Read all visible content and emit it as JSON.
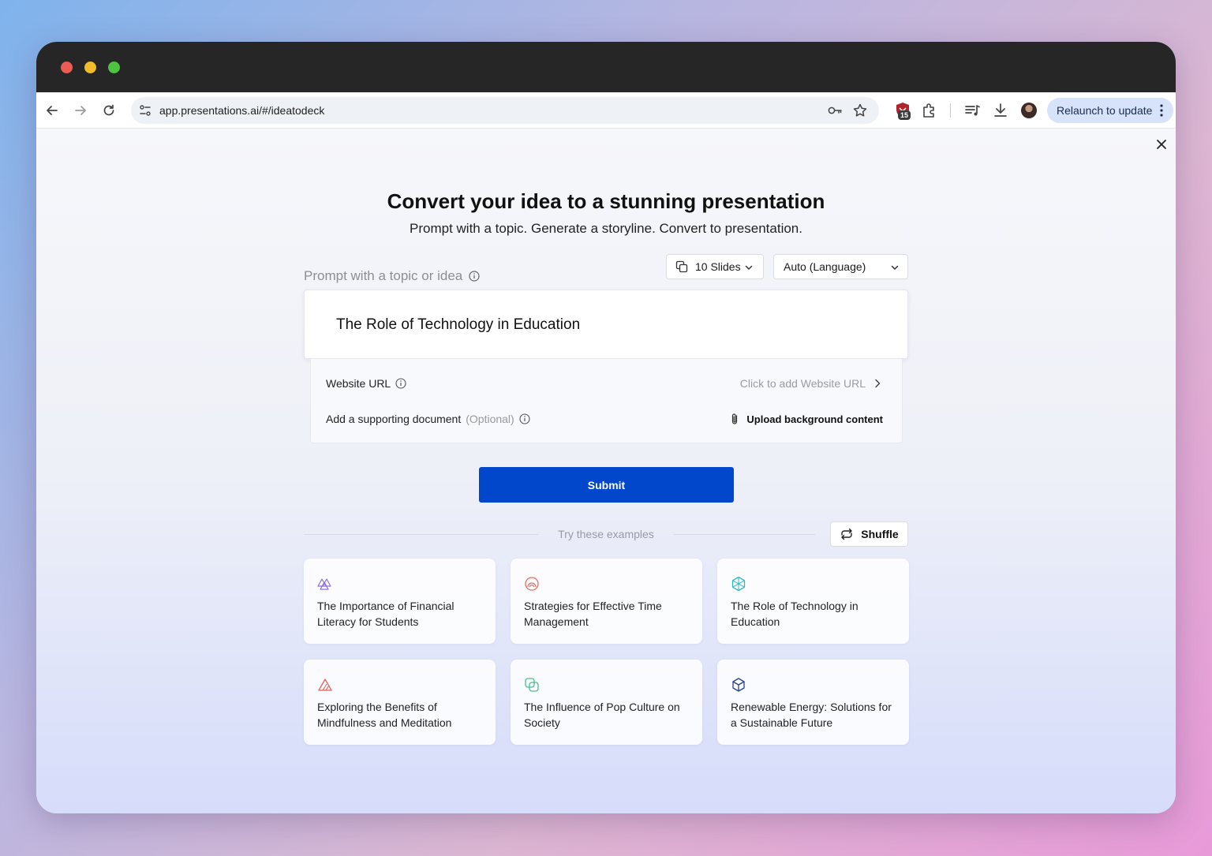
{
  "browser": {
    "url": "app.presentations.ai/#/ideatodeck",
    "extension_badge": "15",
    "relaunch_label": "Relaunch to update"
  },
  "page": {
    "heading": "Convert your idea to a stunning presentation",
    "subheading": "Prompt with a topic. Generate a storyline. Convert to presentation.",
    "prompt_label": "Prompt with a topic or idea",
    "slides_dropdown": "10 Slides",
    "language_dropdown": "Auto (Language)",
    "prompt_value": "The Role of Technology in Education",
    "website_url_label": "Website URL",
    "website_url_action": "Click to add Website URL",
    "supporting_doc_label": "Add a supporting document",
    "supporting_doc_optional": "(Optional)",
    "upload_label": "Upload background content",
    "submit_label": "Submit",
    "examples_label": "Try these examples",
    "shuffle_label": "Shuffle"
  },
  "examples": [
    {
      "text": "The Importance of Financial Literacy for Students",
      "icon": "triangles-icon",
      "color": "#8f6fd8"
    },
    {
      "text": "Strategies for Effective Time Management",
      "icon": "arcs-icon",
      "color": "#e86e5e"
    },
    {
      "text": "The Role of Technology in Education",
      "icon": "hexagon-icon",
      "color": "#2fb9c4"
    },
    {
      "text": "Exploring the Benefits of Mindfulness and Meditation",
      "icon": "striped-triangle-icon",
      "color": "#e8605a"
    },
    {
      "text": "The Influence of Pop Culture on Society",
      "icon": "overlap-squares-icon",
      "color": "#4cbf8a"
    },
    {
      "text": "Renewable Energy: Solutions for a Sustainable Future",
      "icon": "cube-icon",
      "color": "#2a3f8f"
    }
  ],
  "colors": {
    "submit": "#0047cc",
    "titlebar": "#262626",
    "relaunch_bg": "#d6e3fa"
  }
}
